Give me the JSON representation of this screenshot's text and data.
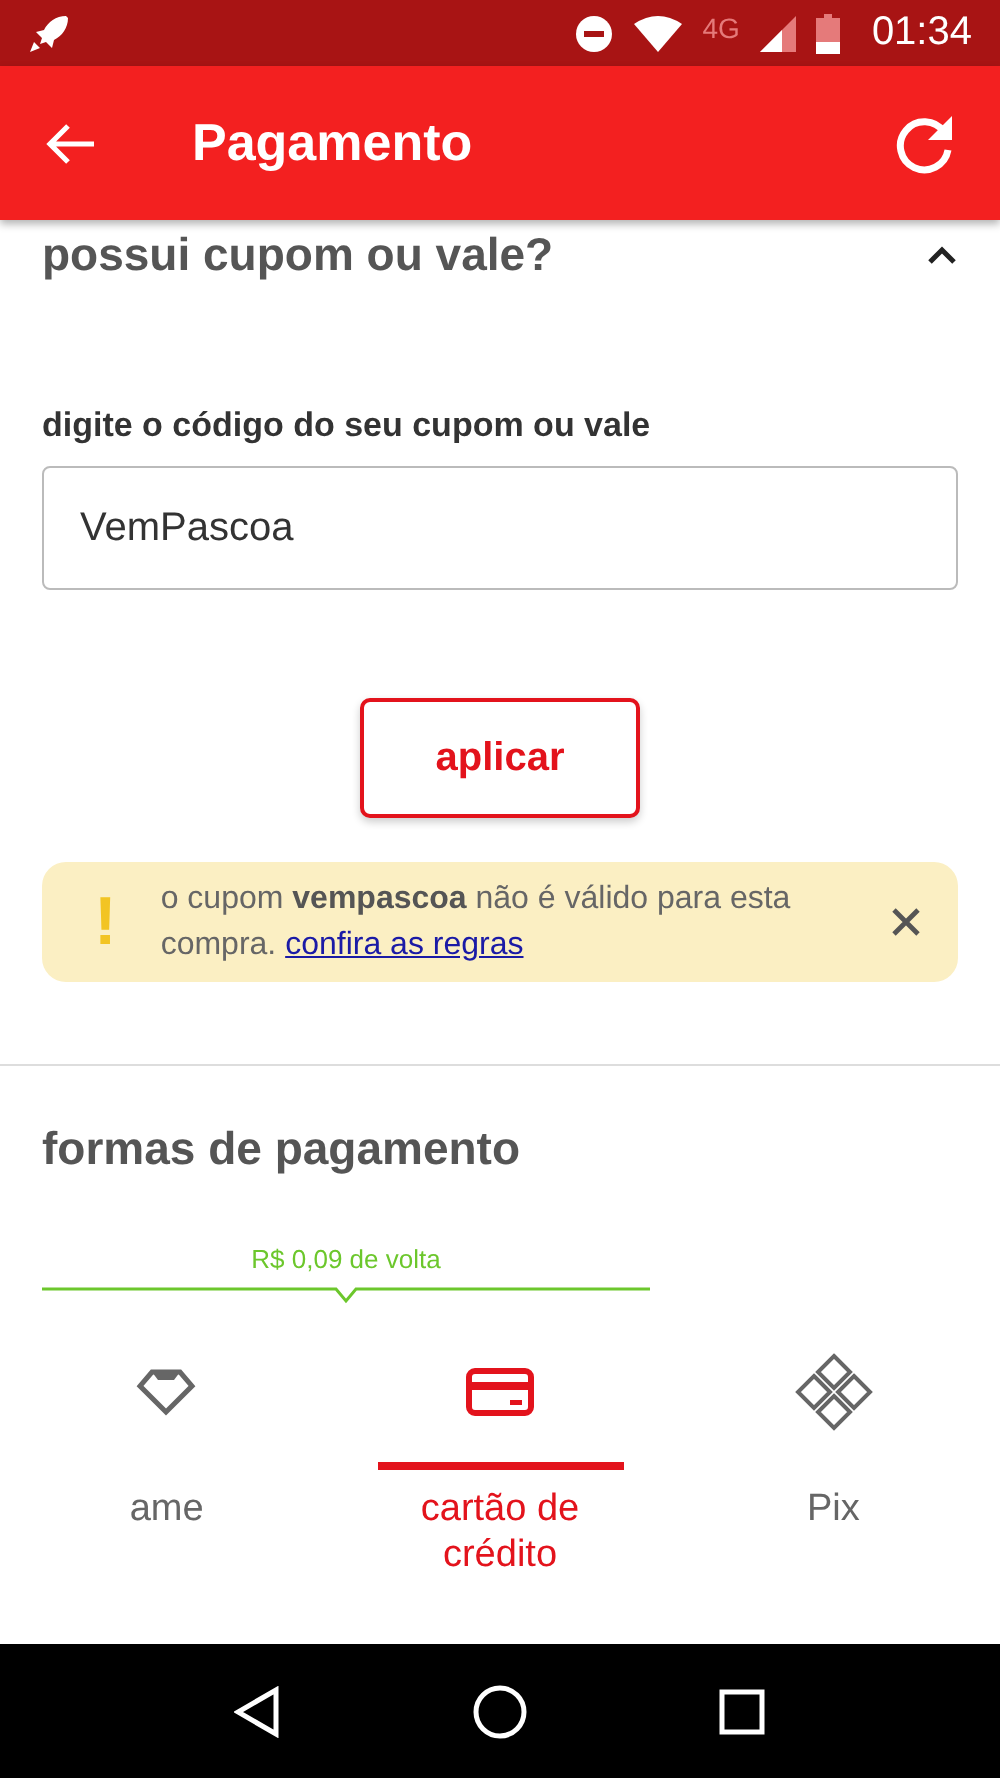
{
  "status_bar": {
    "network": "4G",
    "time": "01:34"
  },
  "app_bar": {
    "title": "Pagamento"
  },
  "coupon": {
    "heading": "possui cupom ou vale?",
    "expanded": true,
    "label": "digite o código do seu cupom ou vale",
    "value": "VemPascoa",
    "button": "aplicar",
    "alert": {
      "icon": "!",
      "text": "o cupom **vempascoa** não é válido para esta compra.",
      "link": "confira as regras"
    }
  },
  "payment": {
    "heading": "formas de pagamento",
    "cashback": "R$ 0,09 de volta",
    "tabs": [
      {
        "kind": "ame",
        "label": "ame",
        "selected": false
      },
      {
        "kind": "card",
        "label": "cartão de crédito",
        "selected": true
      },
      {
        "kind": "pix",
        "label": "Pix",
        "selected": false
      }
    ]
  }
}
